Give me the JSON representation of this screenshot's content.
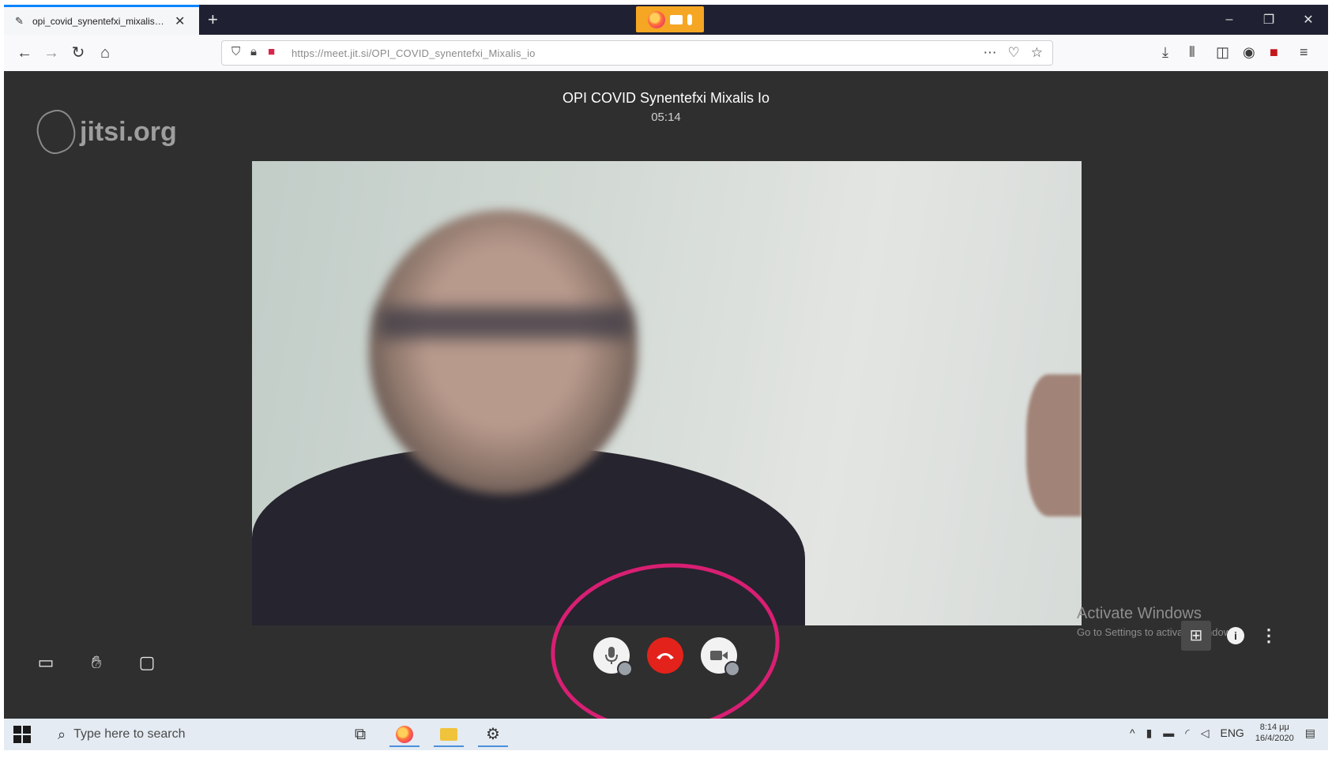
{
  "browser": {
    "tab_title": "opi_covid_synentefxi_mixalis_io",
    "new_tab_symbol": "+",
    "url": "https://meet.jit.si/OPI_COVID_synentefxi_Mixalis_io",
    "window_controls": [
      "–",
      "❐",
      "✕"
    ]
  },
  "meeting": {
    "logo_text": "jitsi.org",
    "subject": "OPI COVID Synentefxi Mixalis Io",
    "timer": "05:14"
  },
  "watermark": {
    "line1": "Activate Windows",
    "line2": "Go to Settings to activate Windows."
  },
  "taskbar": {
    "search_placeholder": "Type here to search",
    "language": "ENG",
    "time": "8:14 μμ",
    "date": "16/4/2020"
  },
  "colors": {
    "hangup_red": "#e3221b",
    "annotation_pink": "#d81f73",
    "sharing_indicator": "#f5a623",
    "tab_accent": "#0a84ff"
  },
  "icons": {
    "toolbar_left": [
      "screen-share-icon",
      "raise-hand-icon",
      "chat-icon"
    ],
    "center": [
      "microphone-icon",
      "hangup-icon",
      "camera-icon"
    ],
    "right": [
      "tile-view-icon",
      "info-icon",
      "more-options-icon"
    ]
  }
}
